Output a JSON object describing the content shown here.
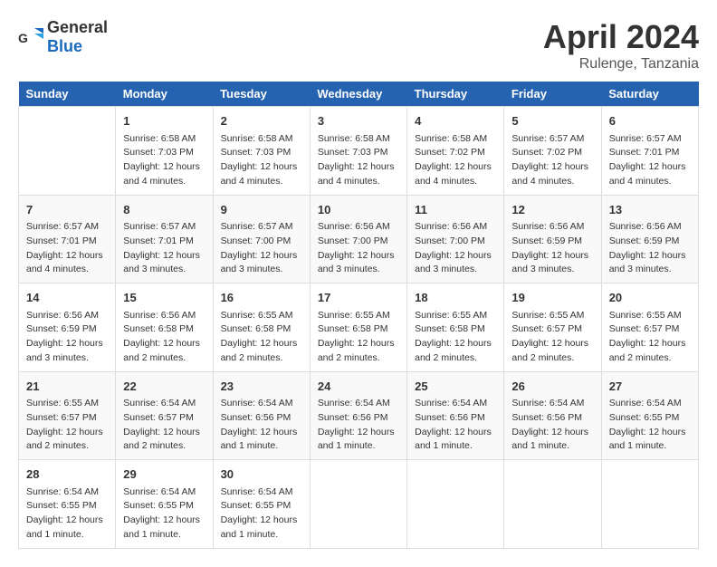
{
  "header": {
    "logo_general": "General",
    "logo_blue": "Blue",
    "month": "April 2024",
    "location": "Rulenge, Tanzania"
  },
  "days_of_week": [
    "Sunday",
    "Monday",
    "Tuesday",
    "Wednesday",
    "Thursday",
    "Friday",
    "Saturday"
  ],
  "weeks": [
    [
      {
        "day": "",
        "info": ""
      },
      {
        "day": "1",
        "info": "Sunrise: 6:58 AM\nSunset: 7:03 PM\nDaylight: 12 hours\nand 4 minutes."
      },
      {
        "day": "2",
        "info": "Sunrise: 6:58 AM\nSunset: 7:03 PM\nDaylight: 12 hours\nand 4 minutes."
      },
      {
        "day": "3",
        "info": "Sunrise: 6:58 AM\nSunset: 7:03 PM\nDaylight: 12 hours\nand 4 minutes."
      },
      {
        "day": "4",
        "info": "Sunrise: 6:58 AM\nSunset: 7:02 PM\nDaylight: 12 hours\nand 4 minutes."
      },
      {
        "day": "5",
        "info": "Sunrise: 6:57 AM\nSunset: 7:02 PM\nDaylight: 12 hours\nand 4 minutes."
      },
      {
        "day": "6",
        "info": "Sunrise: 6:57 AM\nSunset: 7:01 PM\nDaylight: 12 hours\nand 4 minutes."
      }
    ],
    [
      {
        "day": "7",
        "info": "Sunrise: 6:57 AM\nSunset: 7:01 PM\nDaylight: 12 hours\nand 4 minutes."
      },
      {
        "day": "8",
        "info": "Sunrise: 6:57 AM\nSunset: 7:01 PM\nDaylight: 12 hours\nand 3 minutes."
      },
      {
        "day": "9",
        "info": "Sunrise: 6:57 AM\nSunset: 7:00 PM\nDaylight: 12 hours\nand 3 minutes."
      },
      {
        "day": "10",
        "info": "Sunrise: 6:56 AM\nSunset: 7:00 PM\nDaylight: 12 hours\nand 3 minutes."
      },
      {
        "day": "11",
        "info": "Sunrise: 6:56 AM\nSunset: 7:00 PM\nDaylight: 12 hours\nand 3 minutes."
      },
      {
        "day": "12",
        "info": "Sunrise: 6:56 AM\nSunset: 6:59 PM\nDaylight: 12 hours\nand 3 minutes."
      },
      {
        "day": "13",
        "info": "Sunrise: 6:56 AM\nSunset: 6:59 PM\nDaylight: 12 hours\nand 3 minutes."
      }
    ],
    [
      {
        "day": "14",
        "info": "Sunrise: 6:56 AM\nSunset: 6:59 PM\nDaylight: 12 hours\nand 3 minutes."
      },
      {
        "day": "15",
        "info": "Sunrise: 6:56 AM\nSunset: 6:58 PM\nDaylight: 12 hours\nand 2 minutes."
      },
      {
        "day": "16",
        "info": "Sunrise: 6:55 AM\nSunset: 6:58 PM\nDaylight: 12 hours\nand 2 minutes."
      },
      {
        "day": "17",
        "info": "Sunrise: 6:55 AM\nSunset: 6:58 PM\nDaylight: 12 hours\nand 2 minutes."
      },
      {
        "day": "18",
        "info": "Sunrise: 6:55 AM\nSunset: 6:58 PM\nDaylight: 12 hours\nand 2 minutes."
      },
      {
        "day": "19",
        "info": "Sunrise: 6:55 AM\nSunset: 6:57 PM\nDaylight: 12 hours\nand 2 minutes."
      },
      {
        "day": "20",
        "info": "Sunrise: 6:55 AM\nSunset: 6:57 PM\nDaylight: 12 hours\nand 2 minutes."
      }
    ],
    [
      {
        "day": "21",
        "info": "Sunrise: 6:55 AM\nSunset: 6:57 PM\nDaylight: 12 hours\nand 2 minutes."
      },
      {
        "day": "22",
        "info": "Sunrise: 6:54 AM\nSunset: 6:57 PM\nDaylight: 12 hours\nand 2 minutes."
      },
      {
        "day": "23",
        "info": "Sunrise: 6:54 AM\nSunset: 6:56 PM\nDaylight: 12 hours\nand 1 minute."
      },
      {
        "day": "24",
        "info": "Sunrise: 6:54 AM\nSunset: 6:56 PM\nDaylight: 12 hours\nand 1 minute."
      },
      {
        "day": "25",
        "info": "Sunrise: 6:54 AM\nSunset: 6:56 PM\nDaylight: 12 hours\nand 1 minute."
      },
      {
        "day": "26",
        "info": "Sunrise: 6:54 AM\nSunset: 6:56 PM\nDaylight: 12 hours\nand 1 minute."
      },
      {
        "day": "27",
        "info": "Sunrise: 6:54 AM\nSunset: 6:55 PM\nDaylight: 12 hours\nand 1 minute."
      }
    ],
    [
      {
        "day": "28",
        "info": "Sunrise: 6:54 AM\nSunset: 6:55 PM\nDaylight: 12 hours\nand 1 minute."
      },
      {
        "day": "29",
        "info": "Sunrise: 6:54 AM\nSunset: 6:55 PM\nDaylight: 12 hours\nand 1 minute."
      },
      {
        "day": "30",
        "info": "Sunrise: 6:54 AM\nSunset: 6:55 PM\nDaylight: 12 hours\nand 1 minute."
      },
      {
        "day": "",
        "info": ""
      },
      {
        "day": "",
        "info": ""
      },
      {
        "day": "",
        "info": ""
      },
      {
        "day": "",
        "info": ""
      }
    ]
  ]
}
